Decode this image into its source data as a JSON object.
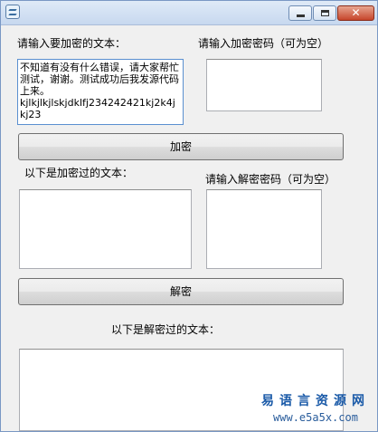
{
  "encrypt": {
    "input_label": "请输入要加密的文本：",
    "input_text": "不知道有没有什么错误，请大家帮忙测试，谢谢。测试成功后我发源代码上来。\nkjlkjlkjlskjdklfj2342424​21kj2k4jkj23",
    "password_label": "请输入加密密码（可为空）",
    "password_value": "",
    "button_label": "加密"
  },
  "decrypt": {
    "input_label": "以下是加密过的文本：",
    "input_text": "",
    "password_label": "请输入解密密码（可为空）",
    "password_value": "",
    "button_label": "解密"
  },
  "output": {
    "label": "以下是解密过的文本：",
    "text": ""
  },
  "watermark": {
    "site_name": "易语言资源网",
    "url": "www.e5a5x.com"
  }
}
